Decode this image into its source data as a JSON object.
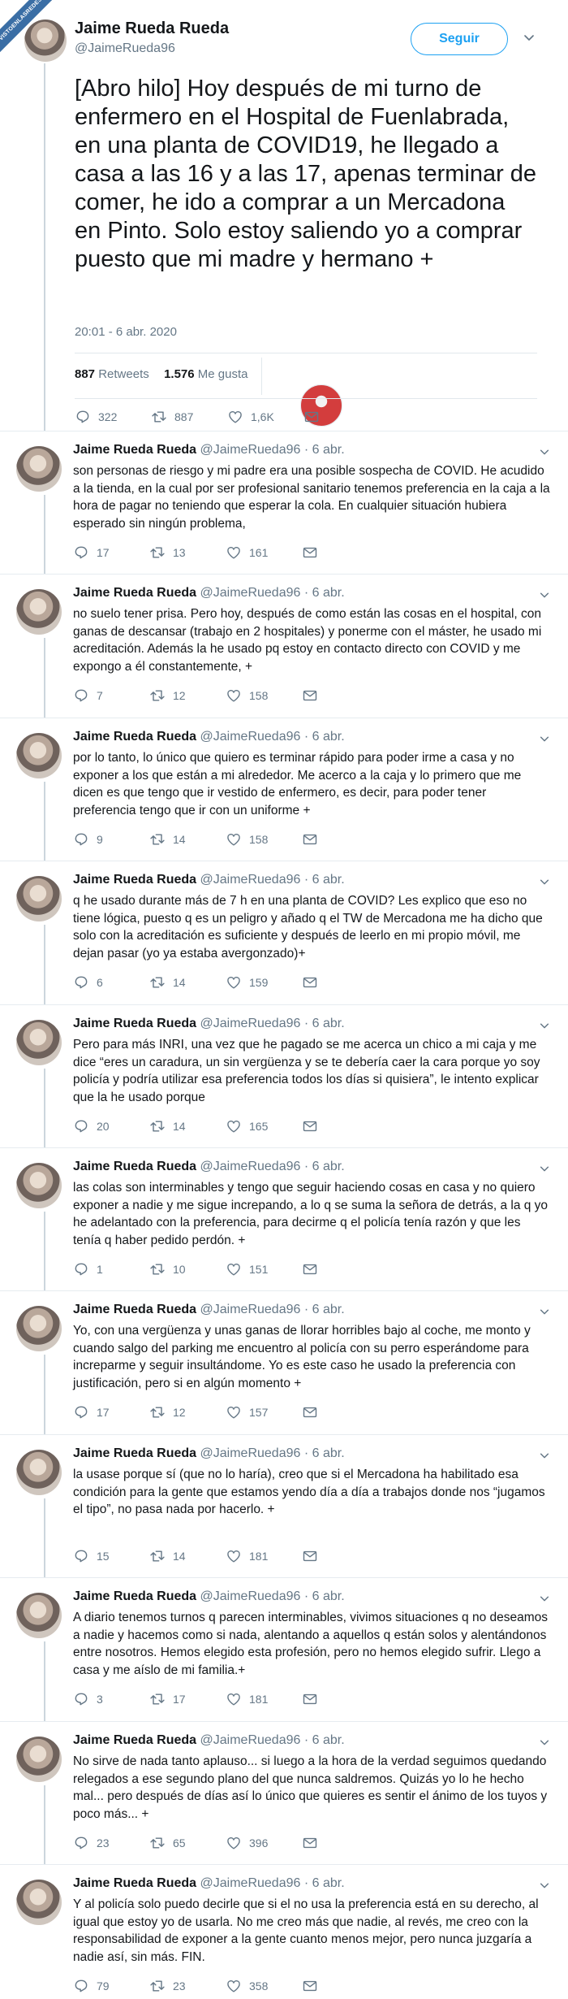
{
  "watermark": "VISTOENLASREDES",
  "main_tweet": {
    "author_name": "Jaime Rueda Rueda",
    "author_handle": "@JaimeRueda96",
    "follow_label": "Seguir",
    "text": "[Abro hilo] Hoy después de mi turno de enfermero en el Hospital de Fuenlabrada, en una planta de COVID19, he llegado a casa a las 16 y a las 17, apenas terminar de comer, he ido a comprar a un Mercadona en Pinto. Solo estoy saliendo yo a comprar puesto que mi madre y hermano +",
    "timestamp": "20:01 - 6 abr. 2020",
    "retweets_count": "887",
    "retweets_label": "Retweets",
    "likes_count": "1.576",
    "likes_label": "Me gusta",
    "liker_colors": [
      "#9aa0a6",
      "#5b8c6e",
      "#c7c7c7",
      "#f4c430",
      "#3b2f2f",
      "#c9a27a",
      "#aab8c2",
      "#aab8c2",
      "#2b2b2b",
      "#d33d3d"
    ],
    "actions": {
      "replies": "322",
      "retweets": "887",
      "likes": "1,6K"
    }
  },
  "replies": [
    {
      "name": "Jaime Rueda Rueda",
      "handle": "@JaimeRueda96",
      "date": "6 abr.",
      "text": "son personas de riesgo y mi padre era una posible sospecha de COVID. He acudido a la tienda, en la cual por ser profesional sanitario tenemos preferencia en la caja a la hora de pagar no teniendo que esperar la cola. En cualquier situación hubiera esperado sin ningún problema,",
      "replies": "17",
      "retweets": "13",
      "likes": "161"
    },
    {
      "name": "Jaime Rueda Rueda",
      "handle": "@JaimeRueda96",
      "date": "6 abr.",
      "text": "no suelo tener prisa. Pero hoy, después de como están las cosas en el hospital, con ganas de descansar (trabajo en 2 hospitales) y ponerme con el máster, he usado mi acreditación. Además la he usado pq estoy en contacto directo con COVID y me expongo a él constantemente, +",
      "replies": "7",
      "retweets": "12",
      "likes": "158"
    },
    {
      "name": "Jaime Rueda Rueda",
      "handle": "@JaimeRueda96",
      "date": "6 abr.",
      "text": "por lo tanto, lo único que quiero es terminar rápido para poder irme a casa y no exponer a los que están a mi alrededor. Me acerco a la caja y lo primero que me dicen es que tengo que ir vestido de enfermero, es decir, para poder tener preferencia tengo que ir con un uniforme +",
      "replies": "9",
      "retweets": "14",
      "likes": "158"
    },
    {
      "name": "Jaime Rueda Rueda",
      "handle": "@JaimeRueda96",
      "date": "6 abr.",
      "text": "q he usado durante más de 7 h en una planta de COVID? Les explico que eso no tiene lógica, puesto q es un peligro y añado q el TW de Mercadona me ha dicho que solo con la acreditación es suficiente y después de leerlo en mi propio móvil, me dejan pasar (yo ya estaba avergonzado)+",
      "replies": "6",
      "retweets": "14",
      "likes": "159"
    },
    {
      "name": "Jaime Rueda Rueda",
      "handle": "@JaimeRueda96",
      "date": "6 abr.",
      "text": "Pero para más INRI, una vez que he pagado se me acerca un chico a mi caja y me dice “eres un caradura, un sin vergüenza y se te debería caer la cara porque yo soy policía y podría utilizar esa preferencia todos los días si quisiera”, le intento explicar que la he usado porque",
      "replies": "20",
      "retweets": "14",
      "likes": "165"
    },
    {
      "name": "Jaime Rueda Rueda",
      "handle": "@JaimeRueda96",
      "date": "6 abr.",
      "text": "las colas son interminables y tengo que seguir haciendo cosas en casa y no quiero exponer a nadie y me sigue increpando, a lo q se suma la señora de detrás, a la q yo he adelantado con la preferencia, para decirme q el policía tenía razón y que les tenía q haber pedido perdón. +",
      "replies": "1",
      "retweets": "10",
      "likes": "151"
    },
    {
      "name": "Jaime Rueda Rueda",
      "handle": "@JaimeRueda96",
      "date": "6 abr.",
      "text": "Yo, con una vergüenza y unas ganas de llorar horribles bajo al coche, me monto y cuando salgo del parking me encuentro al policía con su perro esperándome para increparme y seguir insultándome. Yo es este caso he usado la preferencia con justificación, pero si en algún momento +",
      "replies": "17",
      "retweets": "12",
      "likes": "157"
    },
    {
      "name": "Jaime Rueda Rueda",
      "handle": "@JaimeRueda96",
      "date": "6 abr.",
      "text": "la usase porque sí (que no lo haría), creo que si el Mercadona ha habilitado esa condición para la gente que estamos yendo día a día a trabajos donde nos “jugamos el tipo”, no pasa nada por hacerlo. +",
      "replies": "15",
      "retweets": "14",
      "likes": "181"
    },
    {
      "name": "Jaime Rueda Rueda",
      "handle": "@JaimeRueda96",
      "date": "6 abr.",
      "text": "A diario tenemos turnos q parecen interminables, vivimos situaciones q no deseamos a nadie y hacemos como si nada, alentando a aquellos q están solos y alentándonos entre nosotros. Hemos elegido esta profesión, pero no hemos elegido sufrir. Llego a casa y me aíslo de mi familia.+",
      "replies": "3",
      "retweets": "17",
      "likes": "181"
    },
    {
      "name": "Jaime Rueda Rueda",
      "handle": "@JaimeRueda96",
      "date": "6 abr.",
      "text": "No sirve de nada tanto aplauso... si luego a la hora de la verdad seguimos quedando relegados a ese segundo plano del que nunca saldremos. Quizás yo lo he hecho mal... pero después de días así lo único que quieres es sentir el ánimo de los tuyos y poco más... +",
      "replies": "23",
      "retweets": "65",
      "likes": "396"
    },
    {
      "name": "Jaime Rueda Rueda",
      "handle": "@JaimeRueda96",
      "date": "6 abr.",
      "text": "Y al policía solo puedo decirle que si el no usa la preferencia está en su derecho, al igual que estoy yo de usarla. No me creo más que nadie, al revés, me creo con la responsabilidad de exponer a la gente cuanto menos mejor, pero nunca juzgaría a nadie así, sin más. FIN.",
      "replies": "79",
      "retweets": "23",
      "likes": "358"
    }
  ]
}
